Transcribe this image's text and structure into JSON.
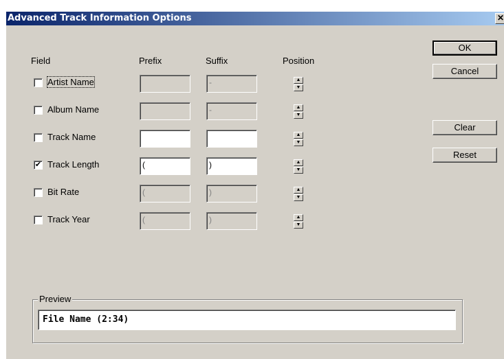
{
  "window": {
    "title": "Advanced Track Information Options",
    "close_glyph": "✕"
  },
  "headers": {
    "field": "Field",
    "prefix": "Prefix",
    "suffix": "Suffix",
    "position": "Position"
  },
  "rows": [
    {
      "label": "Artist Name",
      "checked": false,
      "enabled": false,
      "prefix": "",
      "suffix": "-"
    },
    {
      "label": "Album Name",
      "checked": false,
      "enabled": false,
      "prefix": "",
      "suffix": "-"
    },
    {
      "label": "Track Name",
      "checked": false,
      "enabled": true,
      "prefix": "",
      "suffix": ""
    },
    {
      "label": "Track Length",
      "checked": true,
      "enabled": true,
      "prefix": "(",
      "suffix": ")"
    },
    {
      "label": "Bit Rate",
      "checked": false,
      "enabled": false,
      "prefix": "(",
      "suffix": ")"
    },
    {
      "label": "Track Year",
      "checked": false,
      "enabled": false,
      "prefix": "(",
      "suffix": ")"
    }
  ],
  "buttons": {
    "ok": "OK",
    "cancel": "Cancel",
    "clear": "Clear",
    "reset": "Reset"
  },
  "preview": {
    "label": "Preview",
    "value": "File Name (2:34)"
  },
  "icons": {
    "spin_up": "▲",
    "spin_down": "▼",
    "check": "✔"
  }
}
